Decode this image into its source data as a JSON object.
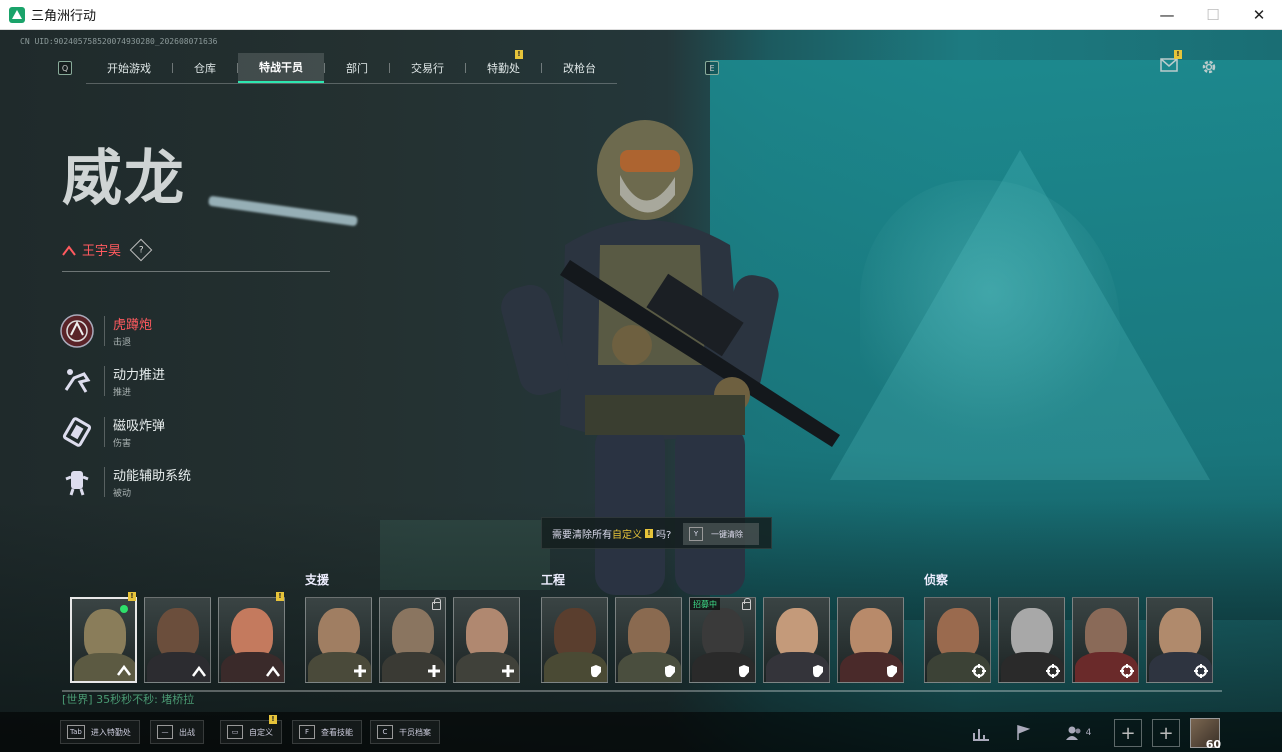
{
  "window": {
    "title": "三角洲行动",
    "min": "—",
    "max": "☐",
    "close": "✕"
  },
  "uid": "CN UID:902405758520074930280_202608071636",
  "nav": {
    "left_key": "Q",
    "right_key": "E",
    "tabs": [
      {
        "label": "开始游戏"
      },
      {
        "label": "仓库"
      },
      {
        "label": "特战干员",
        "active": true
      },
      {
        "label": "部门"
      },
      {
        "label": "交易行"
      },
      {
        "label": "特勤处",
        "badge": "!"
      },
      {
        "label": "改枪台"
      }
    ]
  },
  "mail_badge": "!",
  "hero": {
    "name": "威龙",
    "player": "王宇昊",
    "help": "?"
  },
  "skills": [
    {
      "name": "虎蹲炮",
      "sub": "击退",
      "icon": "artillery-icon",
      "selected": true
    },
    {
      "name": "动力推进",
      "sub": "推进",
      "icon": "dash-icon"
    },
    {
      "name": "磁吸炸弹",
      "sub": "伤害",
      "icon": "magnetic-bomb-icon"
    },
    {
      "name": "动能辅助系统",
      "sub": "被动",
      "icon": "exoskeleton-icon"
    }
  ],
  "tooltip": {
    "pre": "需要清除所有",
    "hl": "自定义",
    "badge": "!",
    "post": "吗?",
    "key": "Y",
    "btn": "一键清除"
  },
  "categories": {
    "support": "支援",
    "engineer": "工程",
    "recon": "侦察"
  },
  "recruit_label": "招募中",
  "chat": "[世界] 35秒秒不秒: 堵桥拉",
  "hints": [
    {
      "key": "Tab",
      "label": "进入特勤处"
    },
    {
      "key": "—",
      "label": "出战"
    },
    {
      "key": "▭",
      "label": "自定义",
      "badge": "!"
    },
    {
      "key": "F",
      "label": "查看技能"
    },
    {
      "key": "C",
      "label": "干员档案"
    }
  ],
  "squad_count": "4",
  "level": "60"
}
